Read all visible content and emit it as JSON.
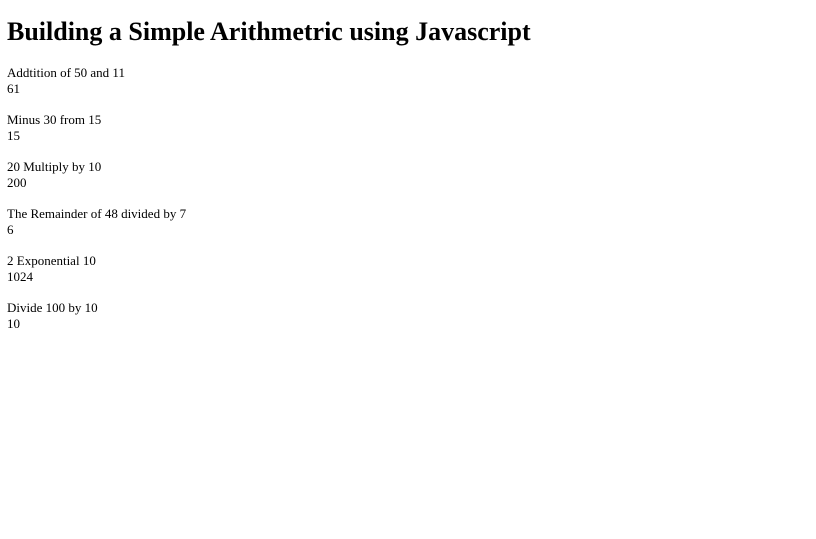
{
  "heading": "Building a Simple Arithmetric using Javascript",
  "operations": [
    {
      "label": "Addtition of 50 and 11",
      "result": "61"
    },
    {
      "label": "Minus 30 from 15",
      "result": "15"
    },
    {
      "label": "20 Multiply by 10",
      "result": "200"
    },
    {
      "label": "The Remainder of 48 divided by 7",
      "result": "6"
    },
    {
      "label": "2 Exponential 10",
      "result": "1024"
    },
    {
      "label": "Divide 100 by 10",
      "result": "10"
    }
  ]
}
